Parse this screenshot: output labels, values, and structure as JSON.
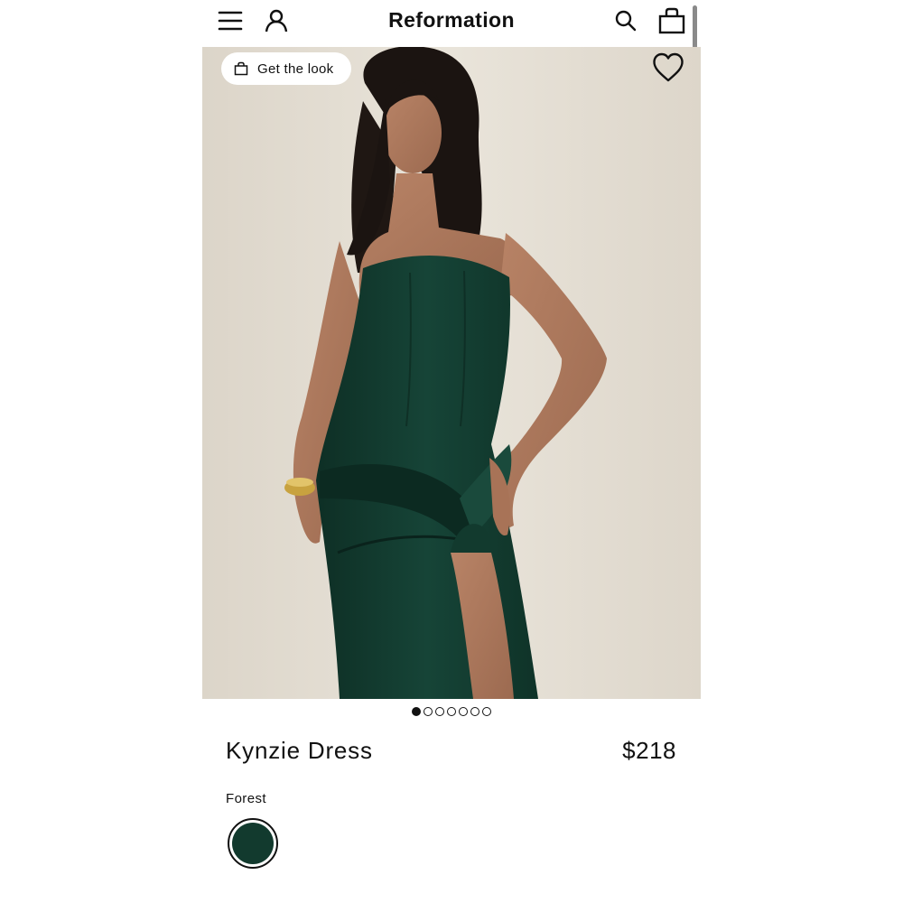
{
  "header": {
    "brand": "Reformation",
    "icons": [
      "menu-icon",
      "account-icon",
      "search-icon",
      "bag-icon"
    ]
  },
  "gallery": {
    "get_the_look_label": "Get the look",
    "image_count": 7,
    "active_index": 0,
    "wishlist_icon": "heart-icon"
  },
  "product": {
    "name": "Kynzie Dress",
    "price": "$218",
    "color_name": "Forest",
    "swatch_color": "#123a2e"
  },
  "colors": {
    "dress": "#123a2e",
    "background": "#e4ded4",
    "text": "#111111"
  }
}
